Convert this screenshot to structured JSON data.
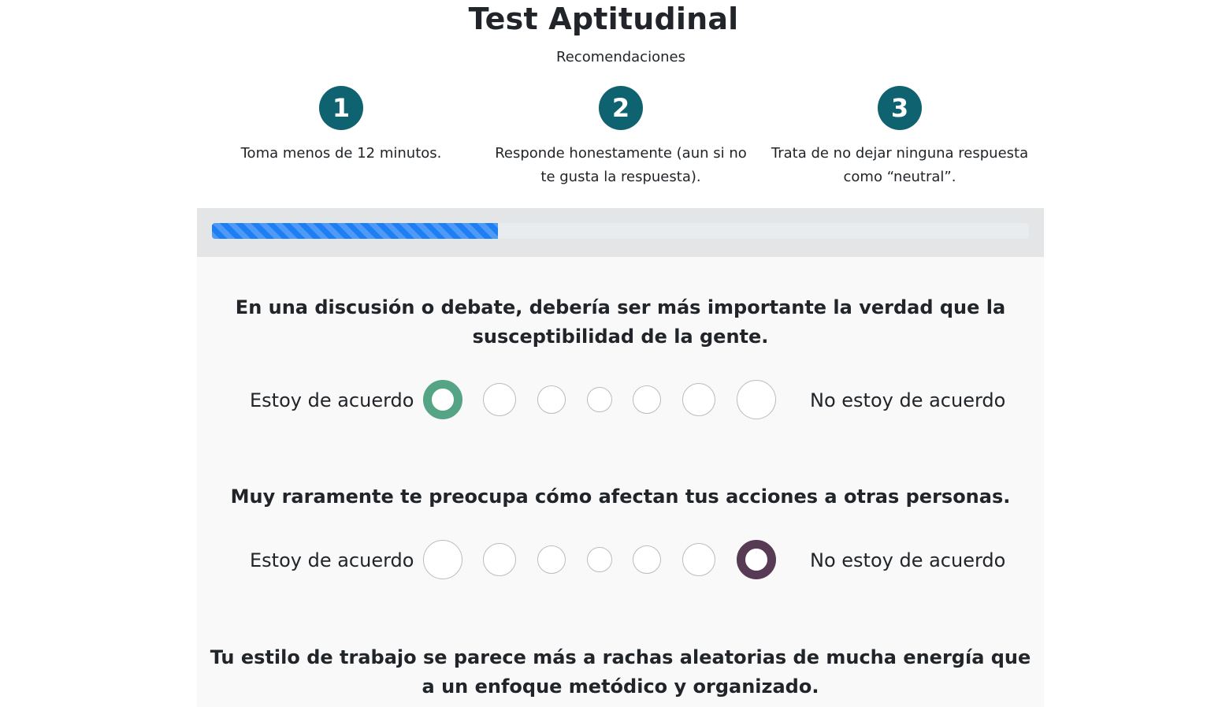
{
  "header": {
    "title": "Test Aptitudinal",
    "subtitle": "Recomendaciones"
  },
  "recommendations": [
    {
      "number": "1",
      "text": "Toma menos de 12 minutos."
    },
    {
      "number": "2",
      "text": "Responde honestamente (aun si no te gusta la respuesta)."
    },
    {
      "number": "3",
      "text": "Trata de no dejar ninguna respuesta como “neutral”."
    }
  ],
  "progress": {
    "fraction": 0.35
  },
  "questions": [
    {
      "text": "En una discusión o debate, debería ser más importante la verdad que la susceptibilidad de la gente.",
      "agree_label": "Estoy de acuerdo",
      "disagree_label": "No estoy de acuerdo",
      "selected_index": 0
    },
    {
      "text": "Muy raramente te preocupa cómo afectan tus acciones a otras personas.",
      "agree_label": "Estoy de acuerdo",
      "disagree_label": "No estoy de acuerdo",
      "selected_index": 6
    },
    {
      "text": "Tu estilo de trabajo se parece más a rachas aleatorias de mucha energía que a un enfoque metódico y organizado."
    }
  ],
  "colors": {
    "step_badge": "#0f6270",
    "progress_fill": "#1e7ef3",
    "agree_selected": "#56a486",
    "disagree_selected": "#573a53"
  }
}
